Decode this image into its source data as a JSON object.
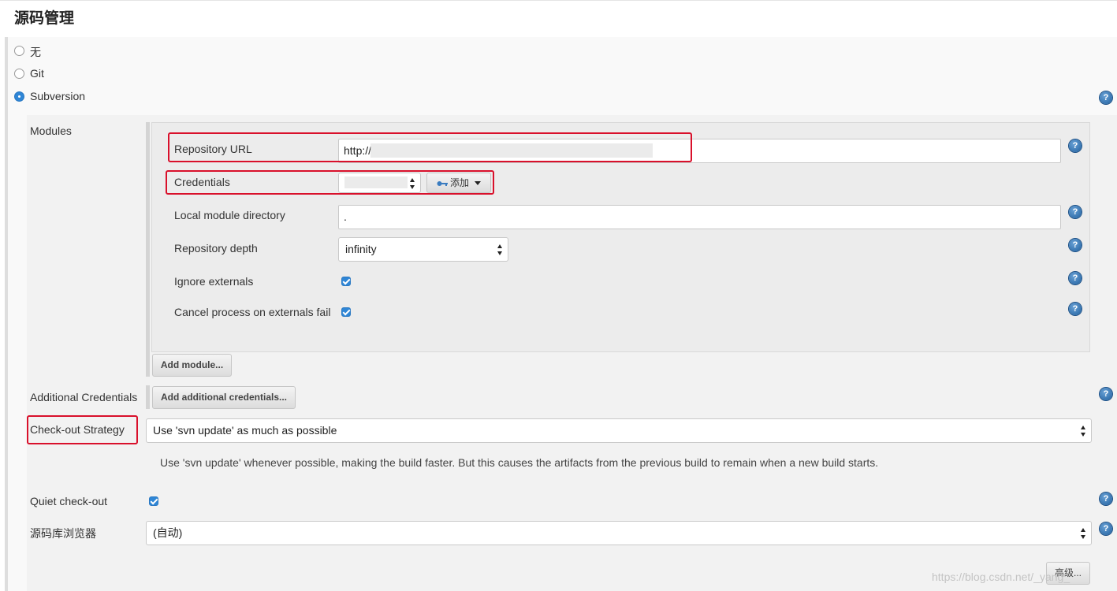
{
  "section": {
    "title": "源码管理"
  },
  "scm_options": [
    {
      "label": "无",
      "selected": false
    },
    {
      "label": "Git",
      "selected": false
    },
    {
      "label": "Subversion",
      "selected": true
    }
  ],
  "modules": {
    "label": "Modules",
    "repository_url": {
      "label": "Repository URL",
      "value": "http://"
    },
    "credentials": {
      "label": "Credentials",
      "add_label": "添加"
    },
    "local_module_directory": {
      "label": "Local module directory",
      "value": "."
    },
    "repository_depth": {
      "label": "Repository depth",
      "value": "infinity"
    },
    "ignore_externals": {
      "label": "Ignore externals",
      "checked": true
    },
    "cancel_on_externals_fail": {
      "label": "Cancel process on externals fail",
      "checked": true
    },
    "add_module_button": "Add module..."
  },
  "additional_credentials": {
    "label": "Additional Credentials",
    "button": "Add additional credentials..."
  },
  "checkout_strategy": {
    "label": "Check-out Strategy",
    "value": "Use 'svn update' as much as possible",
    "description": "Use 'svn update' whenever possible, making the build faster. But this causes the artifacts from the previous build to remain when a new build starts."
  },
  "quiet_checkout": {
    "label": "Quiet check-out",
    "checked": true
  },
  "repo_browser": {
    "label": "源码库浏览器",
    "value": "(自动)"
  },
  "advanced_button": "高级...",
  "help_icon_glyph": "?",
  "watermark": "https://blog.csdn.net/_yang_",
  "colors": {
    "accent": "#2f86d6",
    "highlight_border": "#d9102b",
    "help_icon": "#1f5f9e"
  }
}
